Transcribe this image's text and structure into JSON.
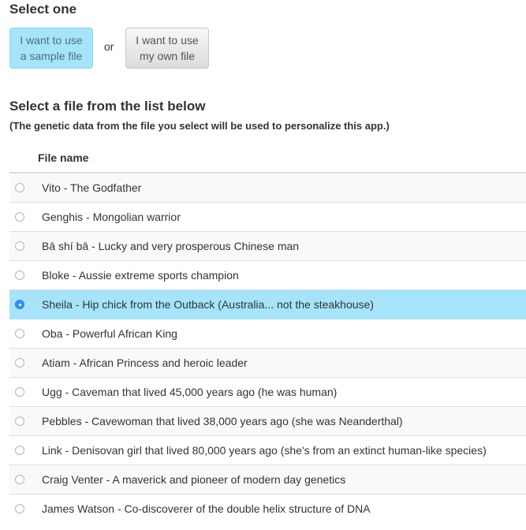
{
  "header": {
    "title": "Select one",
    "sample_button": "I want to use a sample file",
    "or_label": "or",
    "own_button": "I want to use my own file"
  },
  "section": {
    "title": "Select a file from the list below",
    "note": "(The genetic data from the file you select will be used to personalize this app.)",
    "column_header": "File name"
  },
  "files": [
    {
      "label": "Vito - The Godfather",
      "selected": false
    },
    {
      "label": "Genghis - Mongolian warrior",
      "selected": false
    },
    {
      "label": "Bā shí bā - Lucky and very prosperous Chinese man",
      "selected": false
    },
    {
      "label": "Bloke - Aussie extreme sports champion",
      "selected": false
    },
    {
      "label": "Sheila - Hip chick from the Outback (Australia... not the steakhouse)",
      "selected": true
    },
    {
      "label": "Oba - Powerful African King",
      "selected": false
    },
    {
      "label": "Atiam - African Princess and heroic leader",
      "selected": false
    },
    {
      "label": "Ugg - Caveman that lived 45,000 years ago (he was human)",
      "selected": false
    },
    {
      "label": "Pebbles - Cavewoman that lived 38,000 years ago (she was Neanderthal)",
      "selected": false
    },
    {
      "label": "Link - Denisovan girl that lived 80,000 years ago (she's from an extinct human-like species)",
      "selected": false
    },
    {
      "label": "Craig Venter - A maverick and pioneer of modern day genetics",
      "selected": false
    },
    {
      "label": "James Watson - Co-discoverer of the double helix structure of DNA",
      "selected": false
    }
  ],
  "colors": {
    "selected_bg": "#a6e4fb",
    "radio_checked": "#3a8ef2"
  }
}
